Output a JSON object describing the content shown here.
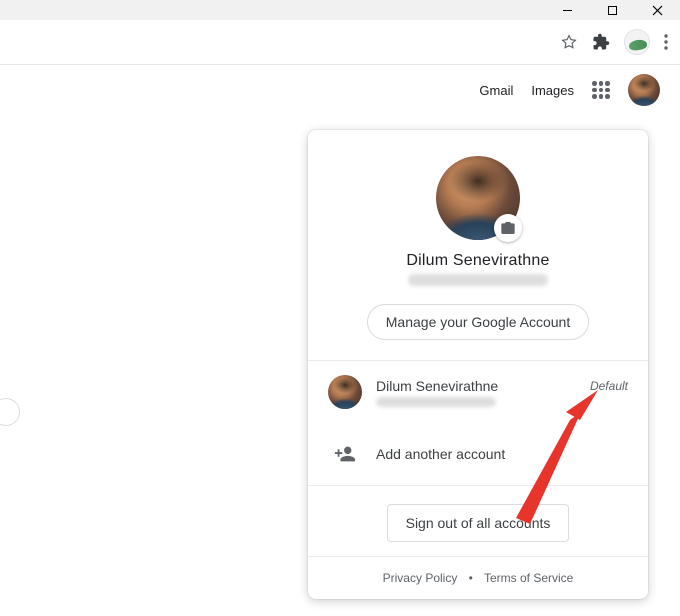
{
  "window": {
    "minimize_label": "minimize",
    "maximize_label": "maximize",
    "close_label": "close"
  },
  "toolbar": {
    "gmail_label": "Gmail",
    "images_label": "Images"
  },
  "popover": {
    "name": "Dilum Senevirathne",
    "manage_label": "Manage your Google Account",
    "other_account": {
      "name": "Dilum Senevirathne",
      "badge": "Default"
    },
    "add_account_label": "Add another account",
    "sign_out_label": "Sign out of all accounts",
    "privacy_label": "Privacy Policy",
    "tos_label": "Terms of Service"
  }
}
